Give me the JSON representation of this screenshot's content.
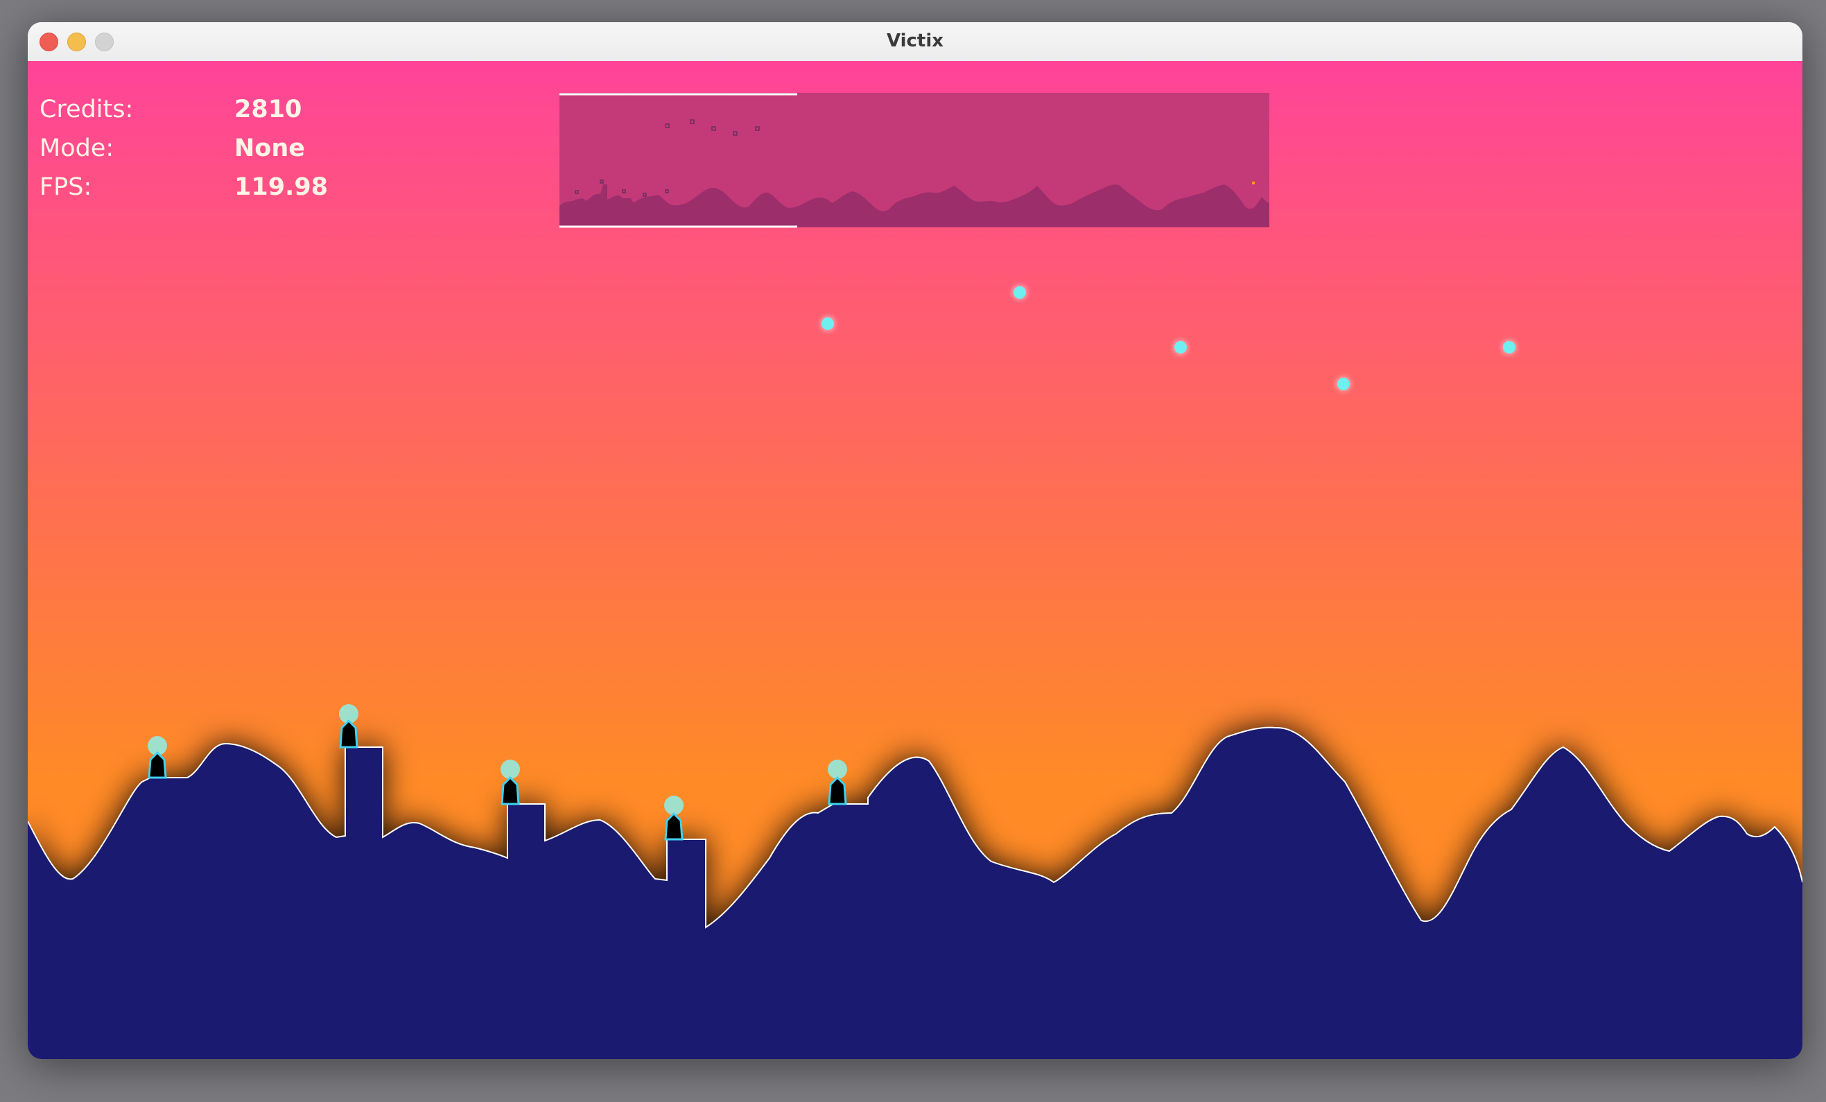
{
  "window": {
    "title": "Victix"
  },
  "hud": {
    "credits_label": "Credits:",
    "credits_value": "2810",
    "mode_label": "Mode:",
    "mode_value": "None",
    "fps_label": "FPS:",
    "fps_value": "119.98"
  },
  "colors": {
    "sky_top": "#ff4499",
    "sky_bottom": "#ff8a26",
    "ground": "#1a1a70",
    "ground_outline": "#ffffff",
    "projectile": "#6ef0f0",
    "turret_orb": "#9ee0cc",
    "turret_body": "#000000",
    "turret_outline": "#3fd2f0",
    "minimap_bg": "#c43a79",
    "minimap_terrain": "#9b2e6b",
    "minimap_viewport": "#ffffff"
  },
  "game": {
    "turret_count": 5,
    "projectile_count": 5
  }
}
